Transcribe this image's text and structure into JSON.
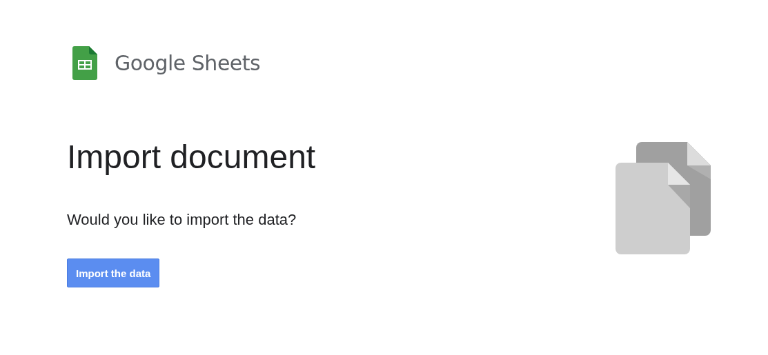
{
  "brand": {
    "name": "Google Sheets"
  },
  "heading": "Import document",
  "question": "Would you like to import the data?",
  "button": {
    "label": "Import the data"
  }
}
